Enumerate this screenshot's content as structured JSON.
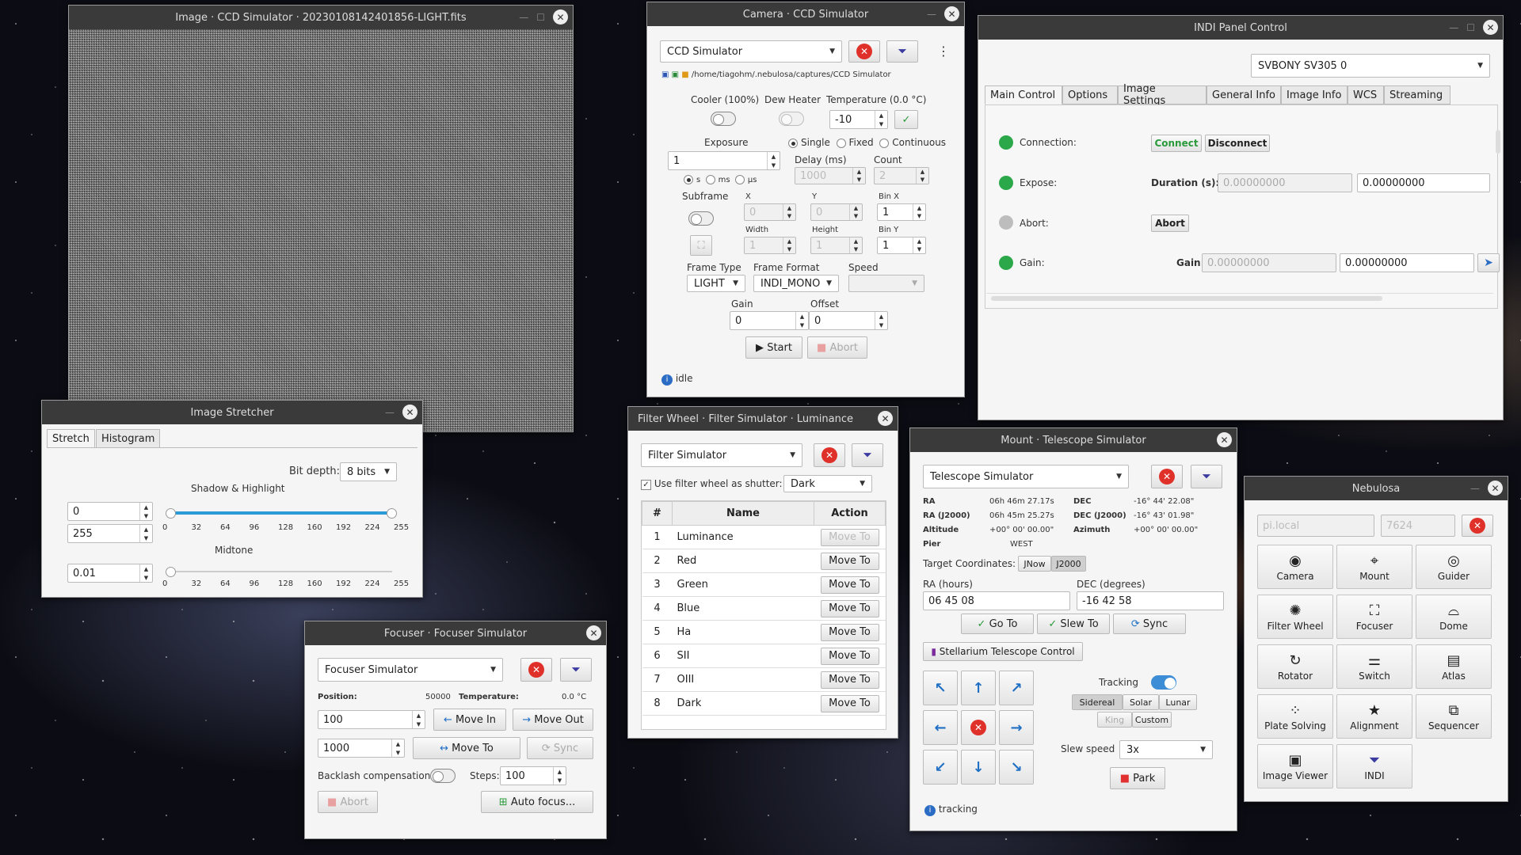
{
  "image_window": {
    "title": "Image · CCD Simulator · 20230108142401856-LIGHT.fits"
  },
  "camera": {
    "title": "Camera · CCD Simulator",
    "device": "CCD Simulator",
    "path": "/home/tiagohm/.nebulosa/captures/CCD Simulator",
    "cooler_label": "Cooler (100%)",
    "dew_label": "Dew Heater",
    "temp_label": "Temperature (0.0 °C)",
    "temp_value": "-10",
    "exposure_label": "Exposure",
    "exposure_value": "1",
    "unit_s": "s",
    "unit_ms": "ms",
    "unit_us": "μs",
    "mode_single": "Single",
    "mode_fixed": "Fixed",
    "mode_continuous": "Continuous",
    "delay_label": "Delay (ms)",
    "delay_value": "1000",
    "count_label": "Count",
    "count_value": "2",
    "subframe_label": "Subframe",
    "x_label": "X",
    "x_value": "0",
    "y_label": "Y",
    "y_value": "0",
    "binx_label": "Bin X",
    "binx_value": "1",
    "width_label": "Width",
    "width_value": "1",
    "height_label": "Height",
    "height_value": "1",
    "biny_label": "Bin Y",
    "biny_value": "1",
    "frametype_label": "Frame Type",
    "frametype_value": "LIGHT",
    "frameformat_label": "Frame Format",
    "frameformat_value": "INDI_MONO",
    "speed_label": "Speed",
    "gain_label": "Gain",
    "gain_value": "0",
    "offset_label": "Offset",
    "offset_value": "0",
    "start_label": "Start",
    "abort_label": "Abort",
    "status": "idle"
  },
  "indi": {
    "title": "INDI Panel Control",
    "device": "SVBONY SV305 0",
    "tabs": [
      "Main Control",
      "Options",
      "Image Settings",
      "General Info",
      "Image Info",
      "WCS",
      "Streaming"
    ],
    "connection_label": "Connection:",
    "connect": "Connect",
    "disconnect": "Disconnect",
    "expose_label": "Expose:",
    "duration_label": "Duration (s):",
    "duration_cur": "0.00000000",
    "duration_new": "0.00000000",
    "abort_label": "Abort:",
    "abort_btn": "Abort",
    "gain_label": "Gain:",
    "gain_sub": "Gain:",
    "gain_cur": "0.00000000",
    "gain_new": "0.00000000",
    "green": "#2aa84a",
    "grey": "#bdbdbd"
  },
  "stretcher": {
    "title": "Image Stretcher",
    "tab_stretch": "Stretch",
    "tab_histogram": "Histogram",
    "bitdepth_label": "Bit depth:",
    "bitdepth_value": "8 bits",
    "shadow_label": "Shadow & Highlight",
    "shadow_value": "0",
    "highlight_value": "255",
    "midtone_label": "Midtone",
    "midtone_value": "0.01",
    "ticks": [
      "0",
      "32",
      "64",
      "96",
      "128",
      "160",
      "192",
      "224",
      "255"
    ]
  },
  "filter": {
    "title": "Filter Wheel · Filter Simulator · Luminance",
    "device": "Filter Simulator",
    "shutter_label": "Use filter wheel as shutter:",
    "shutter_value": "Dark",
    "col_num": "#",
    "col_name": "Name",
    "col_action": "Action",
    "move_to": "Move To",
    "rows": [
      {
        "n": "1",
        "name": "Luminance"
      },
      {
        "n": "2",
        "name": "Red"
      },
      {
        "n": "3",
        "name": "Green"
      },
      {
        "n": "4",
        "name": "Blue"
      },
      {
        "n": "5",
        "name": "Ha"
      },
      {
        "n": "6",
        "name": "SII"
      },
      {
        "n": "7",
        "name": "OIII"
      },
      {
        "n": "8",
        "name": "Dark"
      }
    ]
  },
  "focuser": {
    "title": "Focuser · Focuser Simulator",
    "device": "Focuser Simulator",
    "position_label": "Position:",
    "position_value": "50000",
    "temp_label": "Temperature:",
    "temp_value": "0.0 °C",
    "step_value": "100",
    "move_in": "Move In",
    "move_out": "Move Out",
    "abs_value": "1000",
    "move_to": "Move To",
    "sync": "Sync",
    "backlash_label": "Backlash compensation:",
    "steps_label": "Steps:",
    "steps_value": "100",
    "abort": "Abort",
    "autofocus": "Auto focus..."
  },
  "mount": {
    "title": "Mount · Telescope Simulator",
    "device": "Telescope Simulator",
    "ra_label": "RA",
    "ra_value": "06h 46m 27.17s",
    "dec_label": "DEC",
    "dec_value": "-16° 44' 22.08\"",
    "raj_label": "RA (J2000)",
    "raj_value": "06h 45m 25.27s",
    "decj_label": "DEC (J2000)",
    "decj_value": "-16° 43' 01.98\"",
    "alt_label": "Altitude",
    "alt_value": "+00° 00' 00.00\"",
    "az_label": "Azimuth",
    "az_value": "+00° 00' 00.00\"",
    "pier_label": "Pier",
    "pier_value": "WEST",
    "target_label": "Target Coordinates:",
    "jnow": "JNow",
    "j2000": "J2000",
    "rah_label": "RA (hours)",
    "rah_value": "06 45 08",
    "decd_label": "DEC (degrees)",
    "decd_value": "-16 42 58",
    "goto": "Go To",
    "slew": "Slew To",
    "sync": "Sync",
    "stellarium": "Stellarium Telescope Control",
    "tracking_label": "Tracking",
    "rates": [
      "Sidereal",
      "Solar",
      "Lunar"
    ],
    "king": "King",
    "custom": "Custom",
    "slew_label": "Slew speed",
    "slew_value": "3x",
    "park": "Park",
    "status": "tracking"
  },
  "nebulosa": {
    "title": "Nebulosa",
    "host": "pi.local",
    "port": "7624",
    "tiles": [
      {
        "label": "Camera",
        "icon": "camera-icon"
      },
      {
        "label": "Mount",
        "icon": "telescope-icon"
      },
      {
        "label": "Guider",
        "icon": "target-icon"
      },
      {
        "label": "Filter Wheel",
        "icon": "filter-wheel-icon"
      },
      {
        "label": "Focuser",
        "icon": "focus-icon"
      },
      {
        "label": "Dome",
        "icon": "dome-icon"
      },
      {
        "label": "Rotator",
        "icon": "rotate-icon"
      },
      {
        "label": "Switch",
        "icon": "switch-icon"
      },
      {
        "label": "Atlas",
        "icon": "map-icon"
      },
      {
        "label": "Plate Solving",
        "icon": "plate-icon"
      },
      {
        "label": "Alignment",
        "icon": "star-icon"
      },
      {
        "label": "Sequencer",
        "icon": "sequencer-icon"
      },
      {
        "label": "Image Viewer",
        "icon": "image-icon"
      },
      {
        "label": "INDI",
        "icon": "indi-icon"
      }
    ]
  }
}
